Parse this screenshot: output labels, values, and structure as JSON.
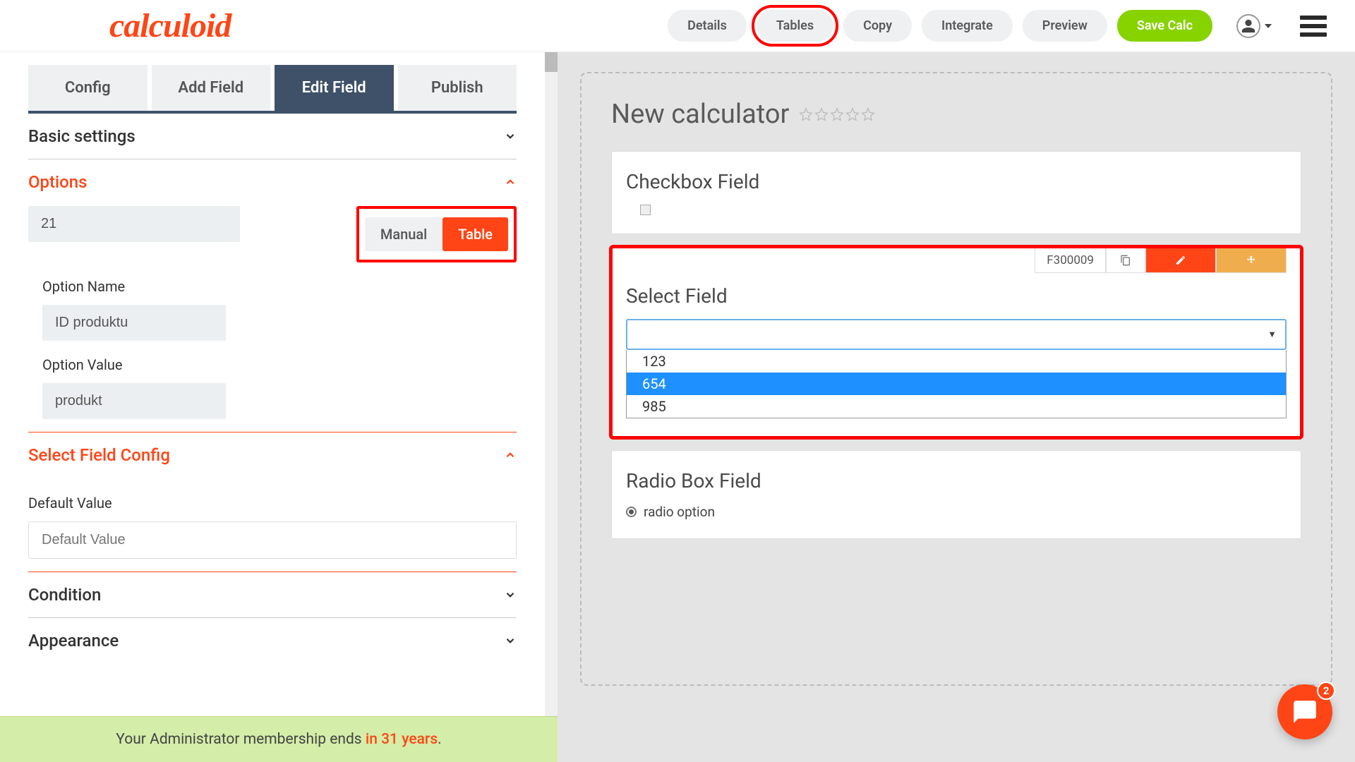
{
  "header": {
    "logo": "calculoid",
    "nav": {
      "details": "Details",
      "tables": "Tables",
      "copy": "Copy",
      "integrate": "Integrate",
      "preview": "Preview",
      "save": "Save Calc"
    }
  },
  "left": {
    "tabs": {
      "config": "Config",
      "add": "Add Field",
      "edit": "Edit Field",
      "publish": "Publish"
    },
    "sections": {
      "basic": "Basic settings",
      "options": "Options",
      "selectConfig": "Select Field Config",
      "condition": "Condition",
      "appearance": "Appearance"
    },
    "options": {
      "numberValue": "21",
      "toggle": {
        "manual": "Manual",
        "table": "Table"
      },
      "optionNameLabel": "Option Name",
      "optionNameValue": "ID produktu",
      "optionValueLabel": "Option Value",
      "optionValueValue": "produkt"
    },
    "selectConfig": {
      "defaultLabel": "Default Value",
      "defaultPlaceholder": "Default Value"
    }
  },
  "footer": {
    "prefix": "Your Administrator membership ends ",
    "highlight": "in 31 years",
    "suffix": "."
  },
  "right": {
    "title": "New calculator",
    "checkbox": {
      "title": "Checkbox Field"
    },
    "select": {
      "id": "F300009",
      "title": "Select Field",
      "options": [
        "123",
        "654",
        "985"
      ],
      "selectedIndex": 1
    },
    "radio": {
      "title": "Radio Box Field",
      "option": "radio option"
    }
  },
  "chat": {
    "badge": "2"
  }
}
